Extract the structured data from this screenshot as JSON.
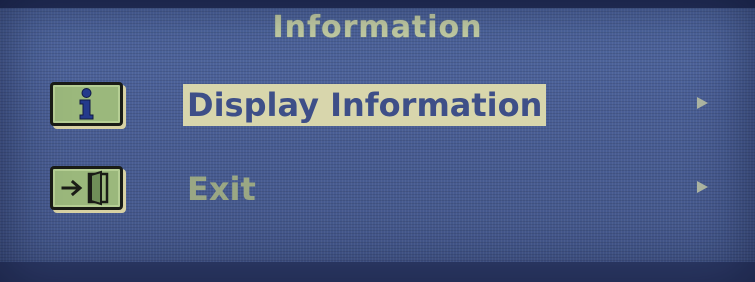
{
  "osd": {
    "title": "Information",
    "menu_items": [
      {
        "label": "Display Information",
        "icon": "info-icon",
        "selected": true,
        "submenu_indicator": "right-triangle-icon"
      },
      {
        "label": "Exit",
        "icon": "exit-door-icon",
        "selected": false,
        "submenu_indicator": "right-triangle-icon"
      }
    ]
  },
  "colors": {
    "background": "#4a5e93",
    "title_text": "#c9d3a8",
    "selected_highlight": "#d8d6ac",
    "selected_text": "#3e4f88",
    "unselected_text": "#9aa784",
    "icon_fill": "#9bb87c"
  }
}
